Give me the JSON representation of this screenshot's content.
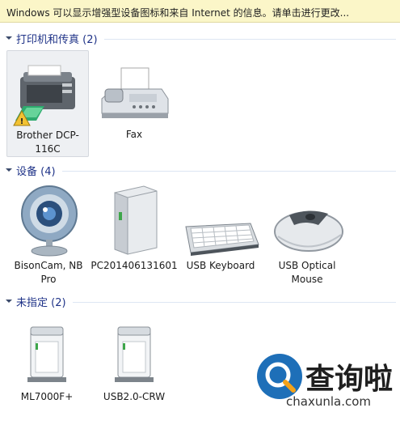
{
  "infobar": {
    "text": "Windows 可以显示增强型设备图标和来自 Internet 的信息。请单击进行更改..."
  },
  "groups": [
    {
      "title": "打印机和传真 (2)",
      "items": [
        {
          "label": "Brother DCP-116C",
          "icon": "printer-warning-icon"
        },
        {
          "label": "Fax",
          "icon": "fax-icon"
        }
      ]
    },
    {
      "title": "设备 (4)",
      "items": [
        {
          "label": "BisonCam, NB Pro",
          "icon": "webcam-icon"
        },
        {
          "label": "PC201406131601",
          "icon": "computer-tower-icon"
        },
        {
          "label": "USB Keyboard",
          "icon": "keyboard-icon"
        },
        {
          "label": "USB Optical Mouse",
          "icon": "mouse-icon"
        }
      ]
    },
    {
      "title": "未指定 (2)",
      "items": [
        {
          "label": "ML7000F+",
          "icon": "generic-device-icon"
        },
        {
          "label": "USB2.0-CRW",
          "icon": "generic-device-icon"
        }
      ]
    }
  ],
  "watermark": {
    "text": "查询啦",
    "url": "chaxunla.com"
  },
  "colors": {
    "infobar_bg": "#fbf6c8",
    "group_title": "#1e3287",
    "selected_bg": "#eef0f3",
    "watermark_blue": "#1e6fb8"
  }
}
